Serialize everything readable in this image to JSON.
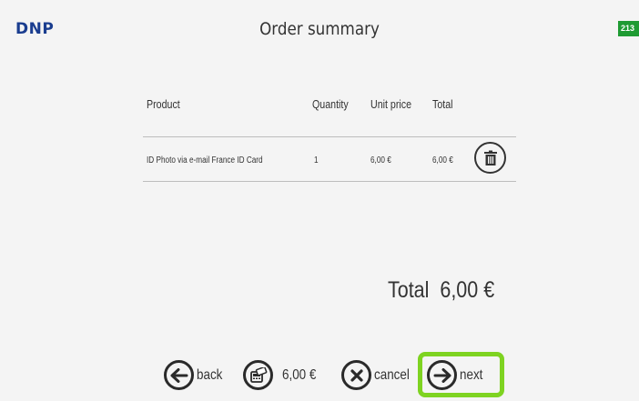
{
  "header": {
    "brand": "DNP",
    "title": "Order summary",
    "badge": "213"
  },
  "table": {
    "columns": [
      "Product",
      "Quantity",
      "Unit price",
      "Total"
    ],
    "rows": [
      {
        "product": "ID Photo via e-mail France ID Card",
        "quantity": "1",
        "unit_price": "6,00 €",
        "total": "6,00 €",
        "delete_icon": "trash-icon"
      }
    ]
  },
  "summary": {
    "total_label": "Total",
    "total_value": "6,00 €"
  },
  "footer": {
    "back_label": "back",
    "price_label": "6,00 €",
    "cancel_label": "cancel",
    "next_label": "next",
    "highlight_color": "#7ed321"
  }
}
